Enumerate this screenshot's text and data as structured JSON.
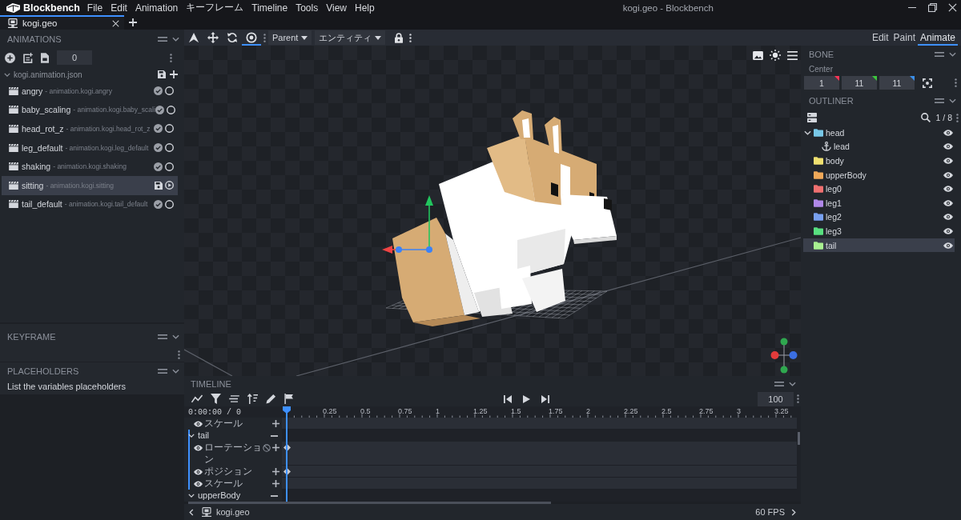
{
  "title_bar": {
    "app_name": "Blockbench",
    "menu": [
      "File",
      "Edit",
      "Animation",
      "キーフレーム",
      "Timeline",
      "Tools",
      "View",
      "Help"
    ],
    "title": "kogi.geo - Blockbench"
  },
  "tabs": [
    {
      "label": "kogi.geo",
      "selected": true
    }
  ],
  "toolbar": {
    "tools": [
      {
        "kind": "pivot",
        "selected": false
      },
      {
        "kind": "move",
        "selected": false
      },
      {
        "kind": "rotate",
        "selected": false
      },
      {
        "kind": "target",
        "selected": true
      }
    ],
    "dropdowns": [
      "Parent",
      "エンティティ"
    ],
    "modes": [
      {
        "label": "Edit",
        "selected": false
      },
      {
        "label": "Paint",
        "selected": false
      },
      {
        "label": "Animate",
        "selected": true
      }
    ]
  },
  "animations": {
    "title": "ANIMATIONS",
    "value": "0",
    "file": {
      "name": "kogi.animation.json",
      "expanded": true
    },
    "items": [
      {
        "name": "angry",
        "detail": "- animation.kogi.angry",
        "saved": true,
        "selected": false
      },
      {
        "name": "baby_scaling",
        "detail": "- animation.kogi.baby_scali",
        "saved": true,
        "selected": false
      },
      {
        "name": "head_rot_z",
        "detail": "- animation.kogi.head_rot_z",
        "saved": true,
        "selected": false
      },
      {
        "name": "leg_default",
        "detail": "- animation.kogi.leg_default",
        "saved": true,
        "selected": false
      },
      {
        "name": "shaking",
        "detail": "- animation.kogi.shaking",
        "saved": true,
        "selected": false
      },
      {
        "name": "sitting",
        "detail": "- animation.kogi.sitting",
        "saved": false,
        "selected": true
      },
      {
        "name": "tail_default",
        "detail": "- animation.kogi.tail_default",
        "saved": true,
        "selected": false
      }
    ]
  },
  "bone": {
    "title": "BONE",
    "label": "Center",
    "values": [
      {
        "value": "1",
        "color": "#ff3355"
      },
      {
        "value": "11",
        "color": "#3cc83c"
      },
      {
        "value": "11",
        "color": "#3b8fea"
      }
    ]
  },
  "outliner": {
    "title": "OUTLINER",
    "count": "1 / 8",
    "items": [
      {
        "kind": "group",
        "name": "head",
        "color": "#78c8e8",
        "expanded": true,
        "selected": false,
        "visible": true,
        "children": [
          {
            "kind": "locator",
            "name": "lead",
            "selected": false,
            "visible": true
          }
        ]
      },
      {
        "kind": "group",
        "name": "body",
        "color": "#f0e070",
        "selected": false,
        "visible": true
      },
      {
        "kind": "group",
        "name": "upperBody",
        "color": "#f0a858",
        "selected": false,
        "visible": true
      },
      {
        "kind": "group",
        "name": "leg0",
        "color": "#f07070",
        "selected": false,
        "visible": true
      },
      {
        "kind": "group",
        "name": "leg1",
        "color": "#b088e8",
        "selected": false,
        "visible": true
      },
      {
        "kind": "group",
        "name": "leg2",
        "color": "#78a0f0",
        "selected": false,
        "visible": true
      },
      {
        "kind": "group",
        "name": "leg3",
        "color": "#58e080",
        "selected": false,
        "visible": true
      },
      {
        "kind": "group",
        "name": "tail",
        "color": "#a8f090",
        "selected": true,
        "visible": true
      }
    ]
  },
  "keyframe": {
    "title": "KEYFRAME"
  },
  "placeholders": {
    "title": "PLACEHOLDERS",
    "text": "List the variables placeholders"
  },
  "timeline": {
    "title": "TIMELINE",
    "time": "0:00:00 / 0",
    "zoom": "100",
    "ruler": [
      "0.25",
      "0.5",
      "0.75",
      "1",
      "1.25",
      "1.5",
      "1.75",
      "2",
      "2.25",
      "2.5",
      "2.75",
      "3",
      "3.25"
    ],
    "tracks": [
      {
        "selected": false,
        "expanded": true,
        "channels": [
          {
            "kind": "scale",
            "label": "スケール",
            "visible": true,
            "keyframe": false
          }
        ]
      },
      {
        "name": "tail",
        "selected": true,
        "expanded": true,
        "channels": [
          {
            "kind": "rotation",
            "label": "ローテーション",
            "visible": true,
            "keyframe": true
          },
          {
            "kind": "position",
            "label": "ポジション",
            "visible": true,
            "keyframe": true
          },
          {
            "kind": "scale",
            "label": "スケール",
            "visible": true,
            "keyframe": false
          }
        ]
      },
      {
        "name": "upperBody",
        "selected": false,
        "expanded": true
      }
    ]
  },
  "status_bar": {
    "file": "kogi.geo",
    "fps": "60 FPS"
  }
}
